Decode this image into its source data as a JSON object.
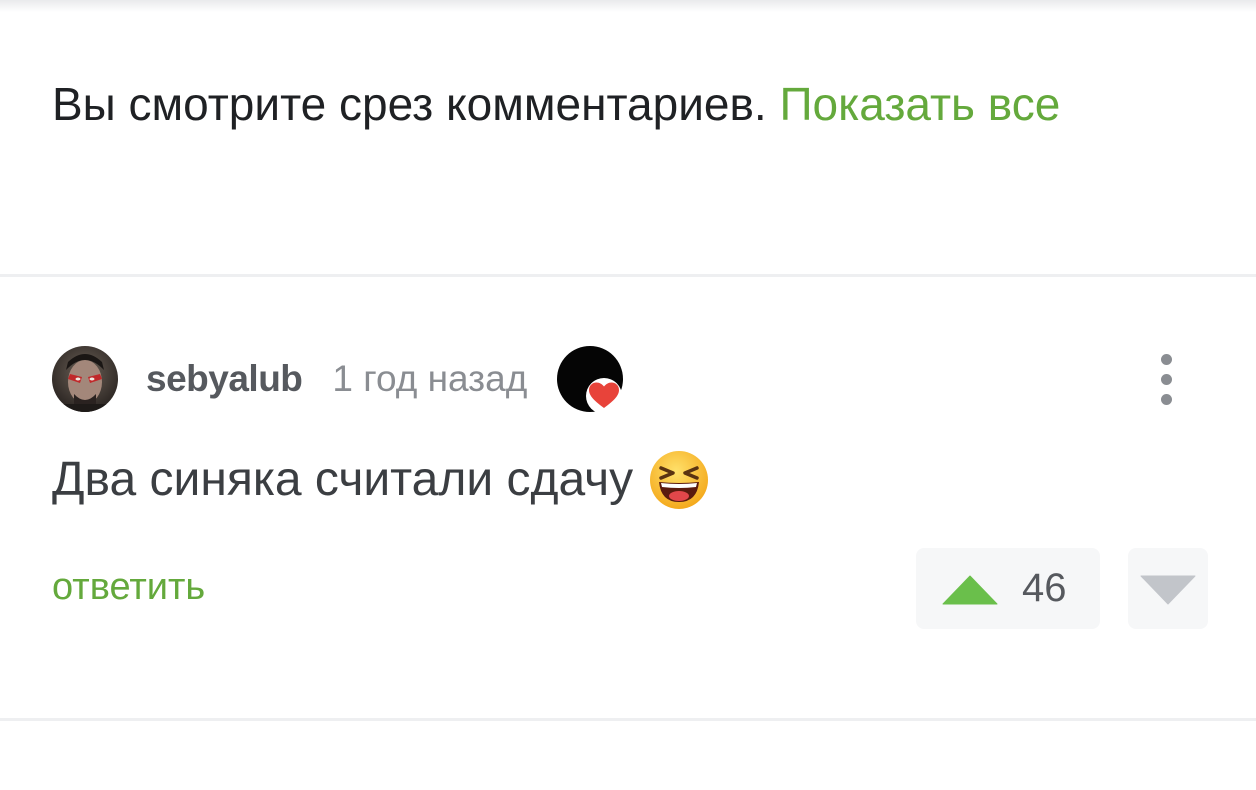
{
  "notice": {
    "text": "Вы смотрите срез комментариев.",
    "show_all_label": "Показать все"
  },
  "comment": {
    "author": "sebyalub",
    "time": "1 год назад",
    "body": "Два синяка считали сдачу",
    "emoji": "grinning-squinting-face",
    "reply_label": "ответить",
    "rating": "46"
  },
  "icons": {
    "avatar": "avatar-image",
    "badge": "heart-badge-icon",
    "menu": "more-vertical-icon",
    "upvote": "upvote-arrow-icon",
    "downvote": "downvote-arrow-icon"
  },
  "colors": {
    "accent_green": "#64a93c",
    "upvote_green": "#6abf4b",
    "downvote_gray": "#c2c5ca",
    "heart_red": "#e8433a",
    "text_dark": "#1f2124",
    "text_muted": "#8a8d92"
  }
}
